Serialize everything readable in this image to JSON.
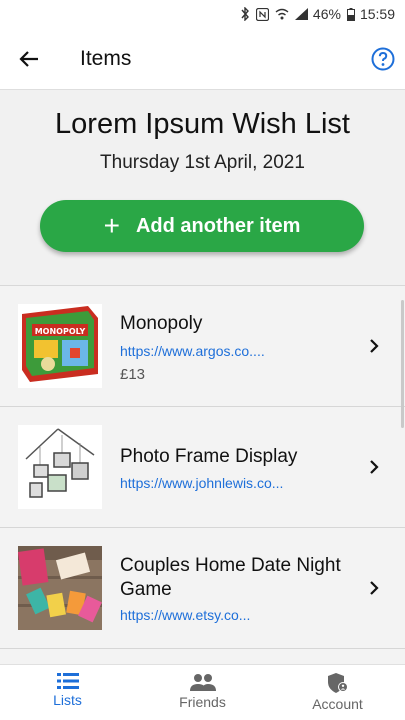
{
  "status_bar": {
    "battery": "46%",
    "time": "15:59"
  },
  "app_bar": {
    "title": "Items"
  },
  "list": {
    "title": "Lorem Ipsum Wish List",
    "date": "Thursday 1st April, 2021",
    "add_button_label": "Add another item"
  },
  "items": [
    {
      "name": "Monopoly",
      "link": "https://www.argos.co....",
      "price": "£13"
    },
    {
      "name": "Photo Frame Display",
      "link": "https://www.johnlewis.co...",
      "price": ""
    },
    {
      "name": "Couples Home Date Night Game",
      "link": "https://www.etsy.co...",
      "price": ""
    }
  ],
  "bottom_nav": {
    "items": [
      {
        "label": "Lists",
        "active": true
      },
      {
        "label": "Friends",
        "active": false
      },
      {
        "label": "Account",
        "active": false
      }
    ]
  },
  "colors": {
    "accent": "#2aa746",
    "link": "#1e6fd9"
  }
}
